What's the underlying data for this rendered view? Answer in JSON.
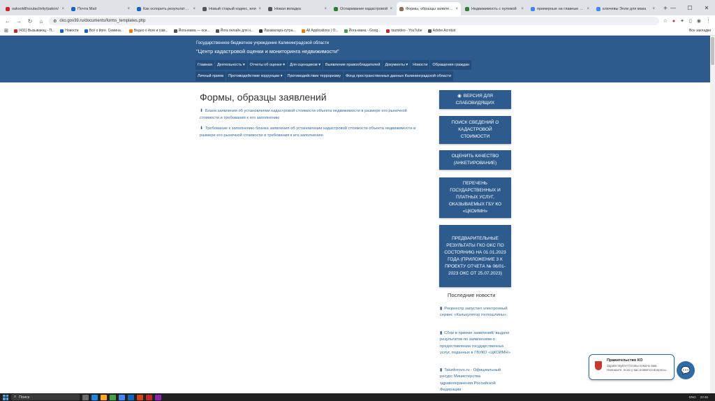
{
  "browser": {
    "tabs": [
      {
        "label": "oaksoldf/soutaclivity/pakon/",
        "color": "#c62828",
        "active": false
      },
      {
        "label": "Почта Mail",
        "color": "#1565c0",
        "active": false
      },
      {
        "label": "Как оспорить результаты кад",
        "color": "#1565c0",
        "active": false
      },
      {
        "label": "Новый старый кодекс, или",
        "color": "#555555",
        "active": false
      },
      {
        "label": "Новая вкладка",
        "color": "#555555",
        "active": false
      },
      {
        "label": "Оспаривание кадастровой",
        "color": "#2e7d32",
        "active": false
      },
      {
        "label": "Формы, образцы заявлений",
        "color": "#8d6e63",
        "active": true
      },
      {
        "label": "Недвижимость с нулевой",
        "color": "#2e7d32",
        "active": false
      },
      {
        "label": "примерные на главные что",
        "color": "#4285f4",
        "active": false
      },
      {
        "label": "ключевы Элли для мака",
        "color": "#4285f4",
        "active": false
      }
    ],
    "new_tab": "+",
    "url": "cko.gov39.ru/documents/forms_templates.php",
    "bookmarks": [
      {
        "label": "(431) Вызывающ - П...",
        "color": "#c62828"
      },
      {
        "label": "Новости",
        "color": "#1565c0"
      },
      {
        "label": "Всё о йоге. Семина...",
        "color": "#1565c0"
      },
      {
        "label": "Видео о йоге и сам...",
        "color": "#f57c00"
      },
      {
        "label": "Йога-мама — оси...",
        "color": "#555555"
      },
      {
        "label": "Йога онлайн для н...",
        "color": "#555555"
      },
      {
        "label": "Лахаватара-сутра...",
        "color": "#333333"
      },
      {
        "label": "All Applications | О...",
        "color": "#f57c00"
      },
      {
        "label": "Йога-мама - Goog...",
        "color": "#43a047"
      },
      {
        "label": "tsumideo - YouTube",
        "color": "#c62828"
      },
      {
        "label": "Adobe Acrobat",
        "color": "#555555"
      }
    ],
    "bookmarks_right": "Все закладки"
  },
  "header": {
    "org_sub": "Государственное бюджетное учреждение Калининградской области",
    "org_title": "\"Центр кадастровой оценки и мониторинга недвижимости\"",
    "nav_row1": [
      "Главная",
      "Деятельность ▾",
      "Отчеты об оценке ▾",
      "Для оценщиков ▾",
      "Выявление правообладателей",
      "Документы ▾",
      "Новости",
      "Обращения граждан"
    ],
    "nav_row2": [
      "Личный прием",
      "Противодействие коррупции ▾",
      "Противодействие терроризму",
      "Фонд пространственных данных Калининградской области"
    ]
  },
  "main": {
    "title": "Формы, образцы заявлений",
    "links": [
      "Бланк заявления об установлении кадастровой стоимости объекта недвижимости в размере его рыночной стоимости и требования к его заполнению",
      "Требование к заполнению бланка заявления об установлении кадастровой стоимости объекта недвижимости в размере его рыночной стоимости и требования к его заполнению"
    ]
  },
  "sidebar": {
    "buttons": [
      "ВЕРСИЯ ДЛЯ СЛАБОВИДЯЩИХ",
      "ПОИСК СВЕДЕНИЙ О КАДАСТРОВОЙ СТОИМОСТИ",
      "ОЦЕНИТЬ КАЧЕСТВО (АНКЕТИРОВАНИЕ)",
      "ПЕРЕЧЕНЬ ГОСУДАРСТВЕННЫХ И ПЛАТНЫХ УСЛУГ, ОКАЗЫВАЕМЫХ ГБУ КО «ЦКОИМН»",
      "ПРЕДВАРИТЕЛЬНЫЕ РЕЗУЛЬТАТЫ ГКО ОКС ПО СОСТОЯНИЮ НА 01.01.2023 ГОДА (ПРИЛОЖЕНИЕ 3 К ПРОЕКТУ ОТЧЕТА № 06/01-2023 ОКС ОТ 25.07.2023)"
    ],
    "news_title": "Последние новости",
    "news": [
      "Росреестр запустил электронный сервис «Калькулятор госпошлины».",
      "Сбои в приеме заявлений/ выдаче результатов по заявлениям о предоставлении государственных услуг, поданных в ГБУКО «ЦКОИМН»",
      "Takzdorovo.ru - Официальный ресурс Министерства здравоохранения Российской Федерации"
    ]
  },
  "chat": {
    "name": "Правительство КО",
    "message": "Здравствуйте! Готовы помочь вам. Напишите, если у вас появятся вопросы."
  },
  "taskbar": {
    "search": "Поиск",
    "lang": "ENG",
    "time": "22:46"
  }
}
